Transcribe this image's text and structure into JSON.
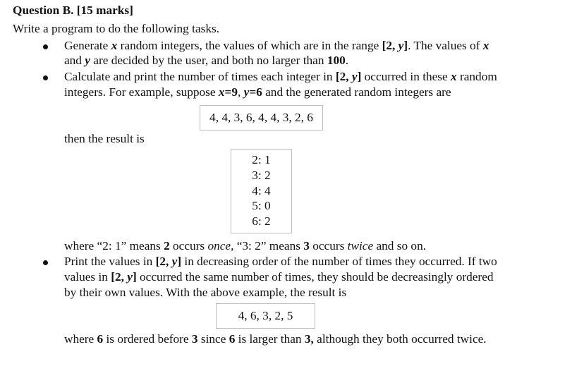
{
  "question": {
    "title": "Question B. [15 marks]",
    "intro": "Write a program to do the following tasks."
  },
  "bullets": [
    {
      "line1": {
        "p1": "Generate ",
        "x": "x",
        "p2": " random integers, the values of which are in the range ",
        "range_open": "[2, ",
        "range_y": "y",
        "range_close": "]",
        "p3": ". The values of ",
        "x2": "x"
      },
      "line2": {
        "p1": "and ",
        "y": "y",
        "p2": " are decided by the user, and both no larger than ",
        "limit": "100",
        "p3": "."
      }
    },
    {
      "line1": {
        "p1": "Calculate and print the number of times each integer in ",
        "range_open": "[2, ",
        "range_y": "y",
        "range_close": "]",
        "p2": " occurred in these ",
        "x": "x",
        "p3": " random"
      },
      "line2": {
        "p1": "integers. For example, suppose ",
        "x": "x",
        "xval": "=9",
        "sep": ", ",
        "y": "y",
        "yval": "=6",
        "p2": " and the generated random integers are"
      }
    },
    {
      "line1": {
        "p1": "Print the values in ",
        "range_open": "[2, ",
        "range_y": "y",
        "range_close": "]",
        "p2": " in decreasing order of the number of times they occurred. If two"
      },
      "line2": {
        "p1": "values in ",
        "range_open": "[2, ",
        "range_y": "y",
        "range_close": "]",
        "p2": " occurred the same number of times, they should be decreasingly ordered"
      },
      "line3": {
        "p1": "by their own values. With the above example, the result is"
      }
    }
  ],
  "example": {
    "random_integers": "4, 4, 3, 6, 4, 4, 3, 2, 6",
    "then_text": "then the result is",
    "counts": [
      "2: 1",
      "3: 2",
      "4: 4",
      "5: 0",
      "6: 2"
    ],
    "explanation": {
      "p1": "where “2: 1” means ",
      "n1": "2",
      "p2": " occurs ",
      "once": "once,",
      "p3": " “3: 2” means ",
      "n2": "3",
      "p4": " occurs ",
      "twice": "twice",
      "p5": " and so on."
    },
    "sorted_result": "4, 6, 3, 2, 5",
    "final": {
      "p1": "where ",
      "n1": "6",
      "p2": " is ordered before ",
      "n2": "3",
      "p3": " since ",
      "n3": "6",
      "p4": " is larger than ",
      "n4": "3,",
      "p5": " although they both occurred twice."
    }
  }
}
